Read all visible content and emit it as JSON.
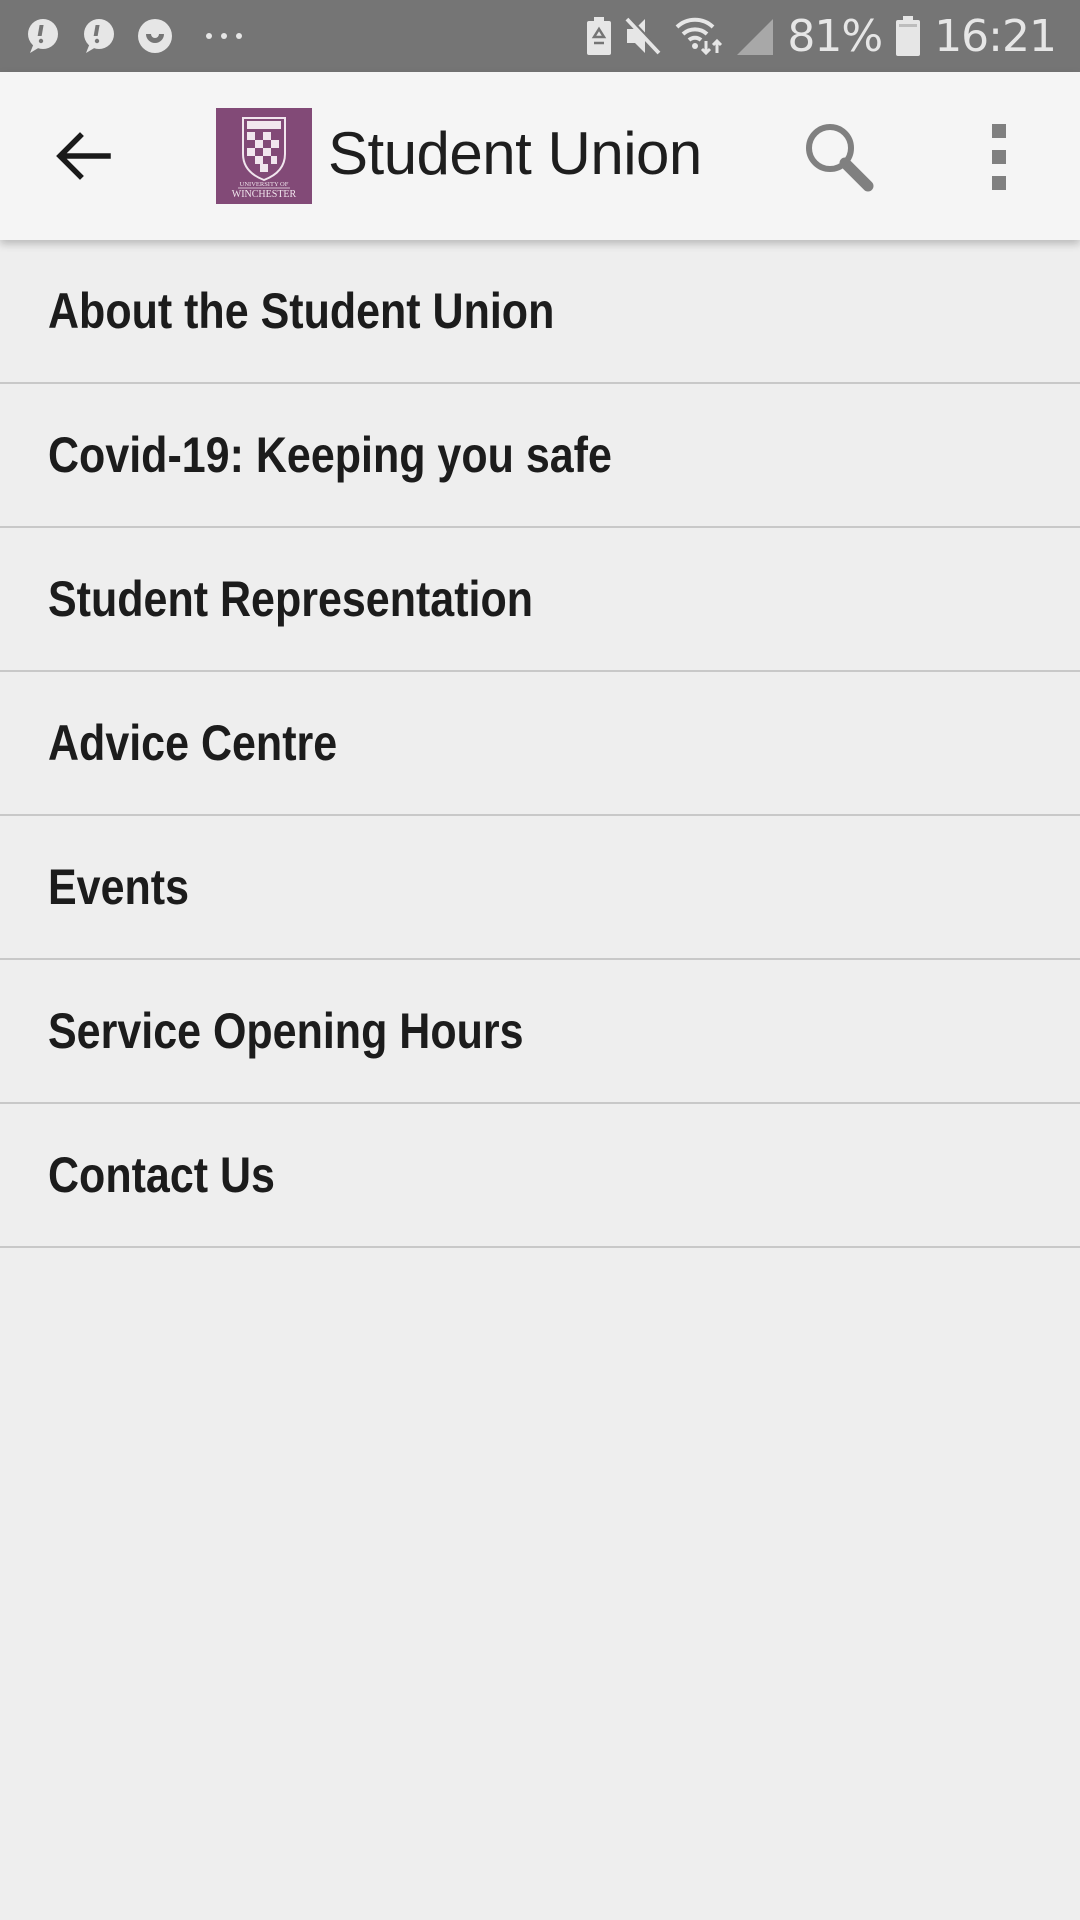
{
  "status_bar": {
    "notifications": [
      "alert-bubble-icon",
      "alert-bubble-icon",
      "smile-app-icon",
      "more-notifications-icon"
    ],
    "system_icons": [
      "battery-saver-icon",
      "mute-icon",
      "wifi-data-icon",
      "cell-signal-icon"
    ],
    "battery_percent": "81%",
    "time": "16:21"
  },
  "app_bar": {
    "back_icon": "arrow-back-icon",
    "logo_text_top": "UNIVERSITY OF",
    "logo_text_bottom": "WINCHESTER",
    "title": "Student Union",
    "search_icon": "search-icon",
    "menu_icon": "more-vert-icon",
    "brand_color": "#824a77"
  },
  "menu": {
    "items": [
      {
        "label": "About the Student Union"
      },
      {
        "label": "Covid-19: Keeping you safe"
      },
      {
        "label": "Student Representation"
      },
      {
        "label": "Advice Centre"
      },
      {
        "label": "Events"
      },
      {
        "label": "Service Opening Hours"
      },
      {
        "label": "Contact Us"
      }
    ]
  }
}
